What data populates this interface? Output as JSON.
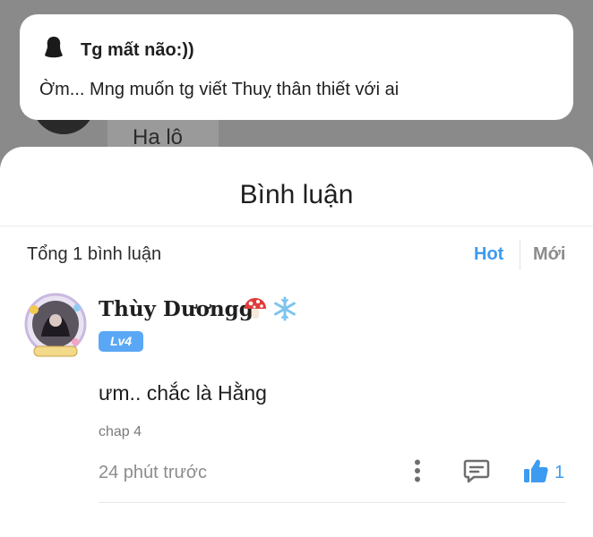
{
  "background": {
    "partial_text": "Ha lô"
  },
  "notification": {
    "title": "Tg mất não:))",
    "body": "Ờm... Mng muốn tg viết Thuỵ thân thiết với ai"
  },
  "comments": {
    "title": "Bình luận",
    "total": "Tổng 1 bình luận",
    "sort_hot": "Hot",
    "sort_new": "Mới",
    "items": [
      {
        "author": "Thùy Dươngg",
        "badges": [
          "mushroom-icon",
          "snowflake-icon"
        ],
        "level": "Lv4",
        "text": "ưm.. chắc là Hằng",
        "chapter": "chap 4",
        "time": "24 phút trước",
        "likes": "1"
      }
    ]
  },
  "colors": {
    "accent": "#3d9bf0",
    "level_badge": "#5aa8f5",
    "overlay": "#8a8a8a"
  }
}
